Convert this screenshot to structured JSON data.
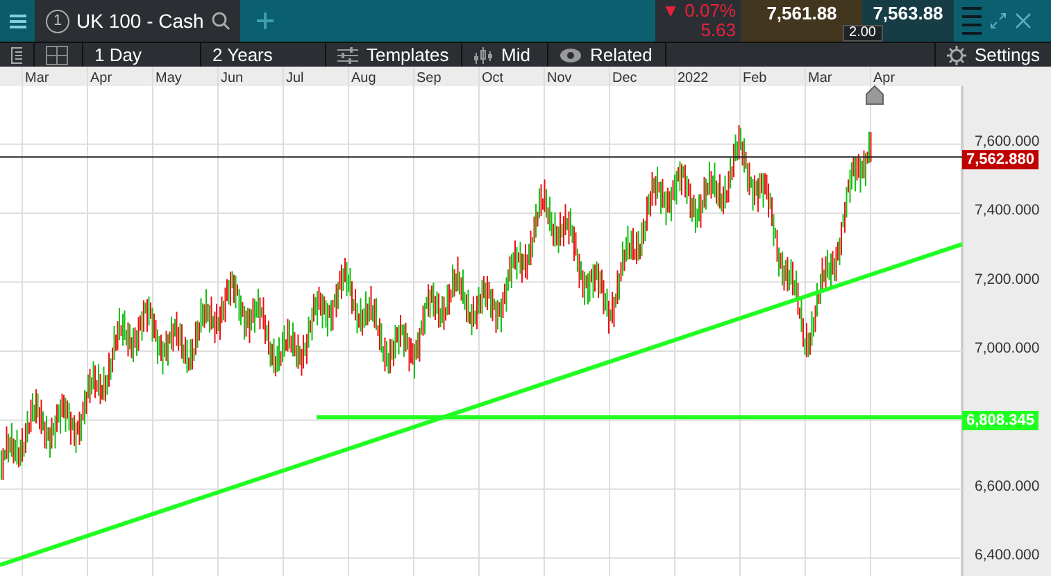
{
  "top_bar": {
    "tab": {
      "number": "1",
      "title": "UK 100 - Cash",
      "selected": true
    },
    "change_percent": "▼ 0.07%",
    "change_points": "5.63",
    "sell_price": "7,561.88",
    "buy_price": "7,563.88",
    "spread": "2.00"
  },
  "toolbar": {
    "interval": "1 Day",
    "range": "2 Years",
    "templates": "Templates",
    "price_type": "Mid",
    "related": "Related",
    "settings": "Settings"
  },
  "chart": {
    "date_axis": [
      "Mar",
      "Apr",
      "May",
      "Jun",
      "Jul",
      "Aug",
      "Sep",
      "Oct",
      "Nov",
      "Dec",
      "2022",
      "Feb",
      "Mar",
      "Apr"
    ],
    "price_axis": [
      "7,600.000",
      "7,400.000",
      "7,200.000",
      "7,000.000",
      "6,600.000",
      "6,400.000"
    ],
    "price_tags": [
      {
        "kind": "current",
        "label": "7,562.880",
        "color": "#c00000"
      },
      {
        "kind": "support",
        "label": "6,808.345",
        "color": "#22ff22"
      }
    ]
  }
}
